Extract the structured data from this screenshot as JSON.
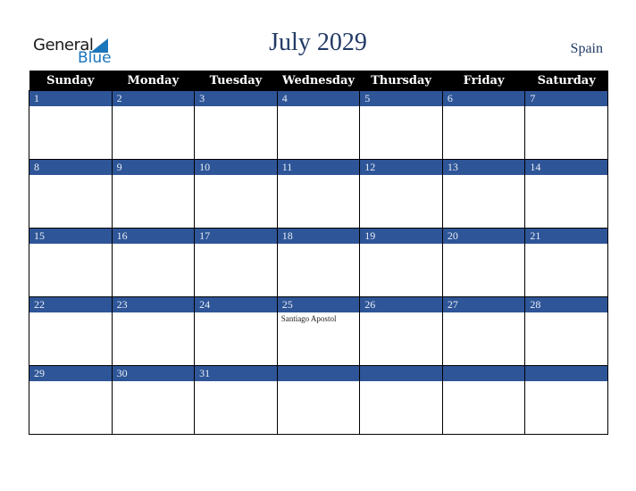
{
  "logo": {
    "line1": "General",
    "line2": "Blue"
  },
  "header": {
    "title": "July 2029",
    "country": "Spain"
  },
  "colors": {
    "header_bg": "#000000",
    "week_bar": "#2e5597",
    "title": "#223a66",
    "logo_blue": "#1b75bb"
  },
  "weekdays": [
    "Sunday",
    "Monday",
    "Tuesday",
    "Wednesday",
    "Thursday",
    "Friday",
    "Saturday"
  ],
  "weeks": [
    [
      {
        "day": "1"
      },
      {
        "day": "2"
      },
      {
        "day": "3"
      },
      {
        "day": "4"
      },
      {
        "day": "5"
      },
      {
        "day": "6"
      },
      {
        "day": "7"
      }
    ],
    [
      {
        "day": "8"
      },
      {
        "day": "9"
      },
      {
        "day": "10"
      },
      {
        "day": "11"
      },
      {
        "day": "12"
      },
      {
        "day": "13"
      },
      {
        "day": "14"
      }
    ],
    [
      {
        "day": "15"
      },
      {
        "day": "16"
      },
      {
        "day": "17"
      },
      {
        "day": "18"
      },
      {
        "day": "19"
      },
      {
        "day": "20"
      },
      {
        "day": "21"
      }
    ],
    [
      {
        "day": "22"
      },
      {
        "day": "23"
      },
      {
        "day": "24"
      },
      {
        "day": "25",
        "event": "Santiago Apostol"
      },
      {
        "day": "26"
      },
      {
        "day": "27"
      },
      {
        "day": "28"
      }
    ],
    [
      {
        "day": "29"
      },
      {
        "day": "30"
      },
      {
        "day": "31"
      },
      {
        "day": ""
      },
      {
        "day": ""
      },
      {
        "day": ""
      },
      {
        "day": ""
      }
    ]
  ]
}
